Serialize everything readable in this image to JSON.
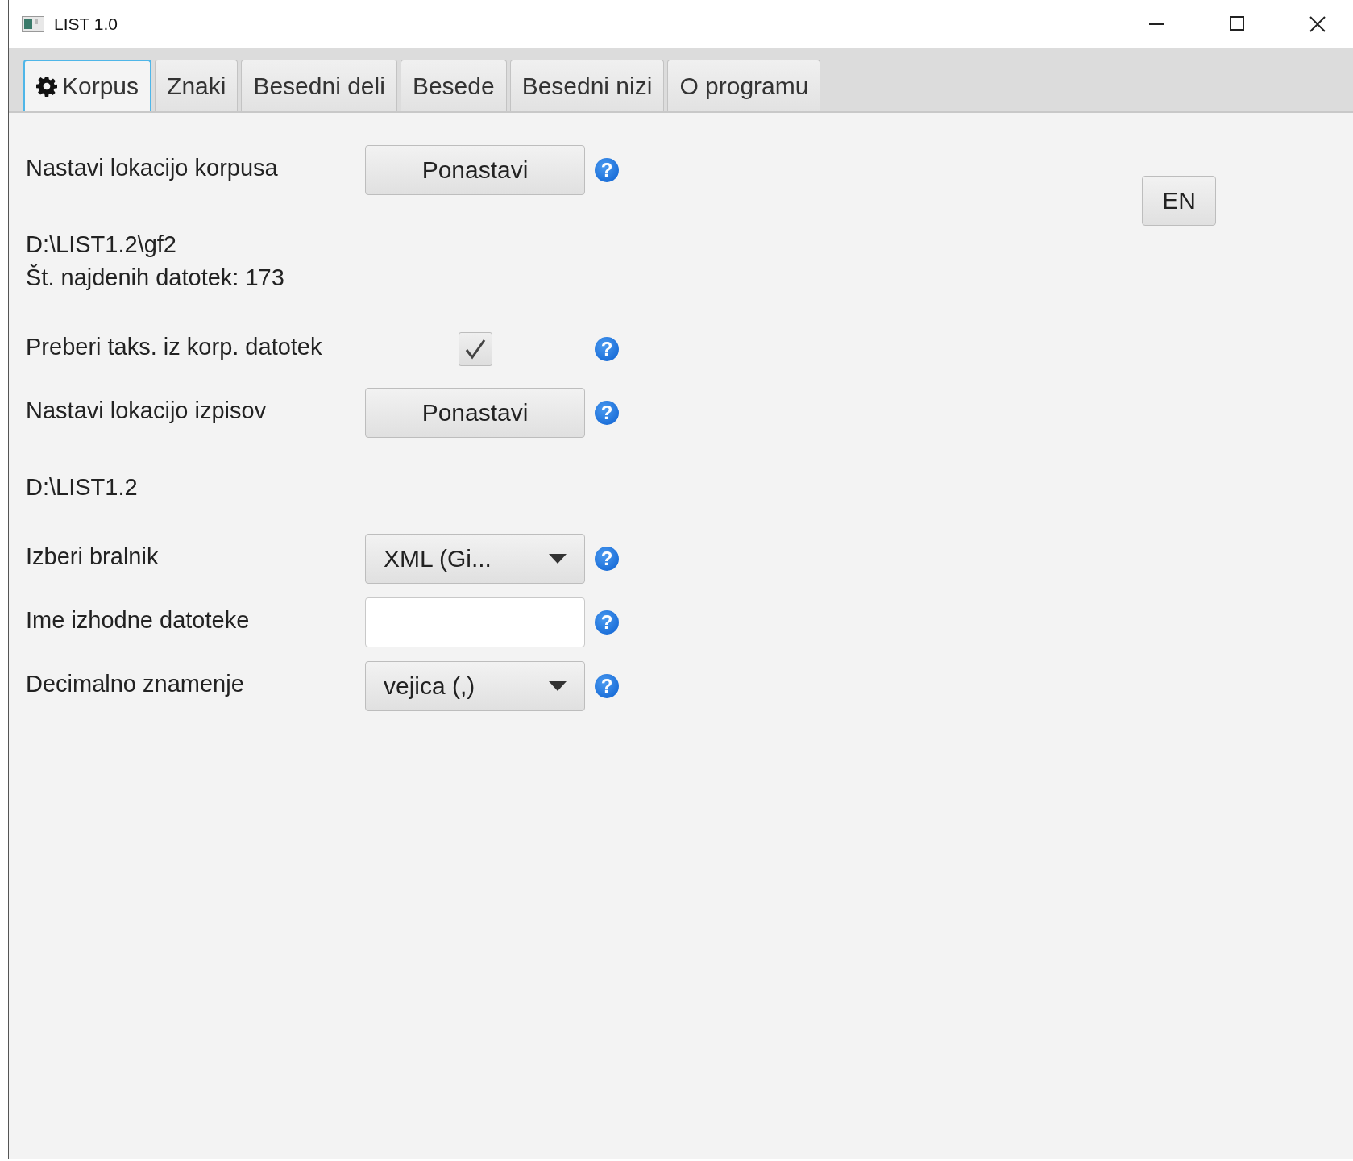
{
  "window": {
    "title": "LIST 1.0"
  },
  "tabs": [
    {
      "label": "Korpus",
      "selected": true,
      "kind": "icon"
    },
    {
      "label": "Znaki",
      "selected": false,
      "kind": "plain"
    },
    {
      "label": "Besedni deli",
      "selected": false,
      "kind": "plain"
    },
    {
      "label": "Besede",
      "selected": false,
      "kind": "plain"
    },
    {
      "label": "Besedni nizi",
      "selected": false,
      "kind": "plain"
    },
    {
      "label": "O programu",
      "selected": false,
      "kind": "plain"
    }
  ],
  "form": [
    {
      "kind": "button",
      "label": "Nastavi lokacijo korpusa",
      "button": "Ponastavi",
      "help": "?"
    },
    {
      "kind": "info",
      "lines": [
        "D:\\LIST1.2\\gf2",
        "Št. najdenih datotek: 173"
      ]
    },
    {
      "kind": "checkbox",
      "label": "Preberi taks. iz korp. datotek",
      "checked": true,
      "help": "?"
    },
    {
      "kind": "button",
      "label": "Nastavi lokacijo izpisov",
      "button": "Ponastavi",
      "help": "?"
    },
    {
      "kind": "info",
      "lines": [
        "D:\\LIST1.2"
      ]
    },
    {
      "kind": "select",
      "label": "Izberi bralnik",
      "value": "XML (Gi...",
      "help": "?"
    },
    {
      "kind": "text",
      "label": "Ime izhodne datoteke",
      "help": "?"
    },
    {
      "kind": "select",
      "label": "Decimalno znamenje",
      "value": "vejica (,)",
      "help": "?"
    }
  ],
  "language_button": "EN"
}
